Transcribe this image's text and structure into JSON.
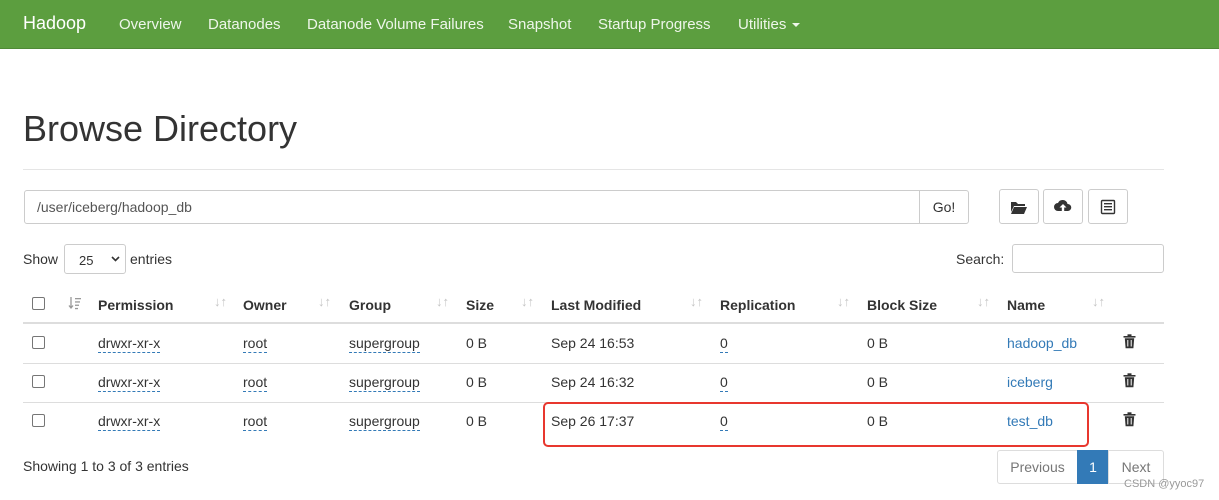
{
  "navbar": {
    "brand": "Hadoop",
    "items": [
      "Overview",
      "Datanodes",
      "Datanode Volume Failures",
      "Snapshot",
      "Startup Progress",
      "Utilities"
    ]
  },
  "page": {
    "title": "Browse Directory",
    "path_value": "/user/iceberg/hadoop_db",
    "go_label": "Go!"
  },
  "toolbar": {
    "icons": [
      "folder-open-icon",
      "cloud-upload-icon",
      "list-icon"
    ]
  },
  "table_controls": {
    "show_label": "Show",
    "entries_value": "25",
    "entries_label": "entries",
    "search_label": "Search:"
  },
  "table": {
    "headers": [
      "Permission",
      "Owner",
      "Group",
      "Size",
      "Last Modified",
      "Replication",
      "Block Size",
      "Name"
    ],
    "rows": [
      {
        "permission": "drwxr-xr-x",
        "owner": "root",
        "group": "supergroup",
        "size": "0 B",
        "modified": "Sep 24 16:53",
        "replication": "0",
        "block_size": "0 B",
        "name": "hadoop_db"
      },
      {
        "permission": "drwxr-xr-x",
        "owner": "root",
        "group": "supergroup",
        "size": "0 B",
        "modified": "Sep 24 16:32",
        "replication": "0",
        "block_size": "0 B",
        "name": "iceberg"
      },
      {
        "permission": "drwxr-xr-x",
        "owner": "root",
        "group": "supergroup",
        "size": "0 B",
        "modified": "Sep 26 17:37",
        "replication": "0",
        "block_size": "0 B",
        "name": "test_db"
      }
    ]
  },
  "footer": {
    "info": "Showing 1 to 3 of 3 entries",
    "previous": "Previous",
    "page": "1",
    "next": "Next"
  },
  "watermark": "CSDN @yyoc97",
  "colors": {
    "navbar": "#5c9e3f",
    "link": "#337ab7",
    "active_page": "#337ab7",
    "highlight": "#e8372e"
  }
}
